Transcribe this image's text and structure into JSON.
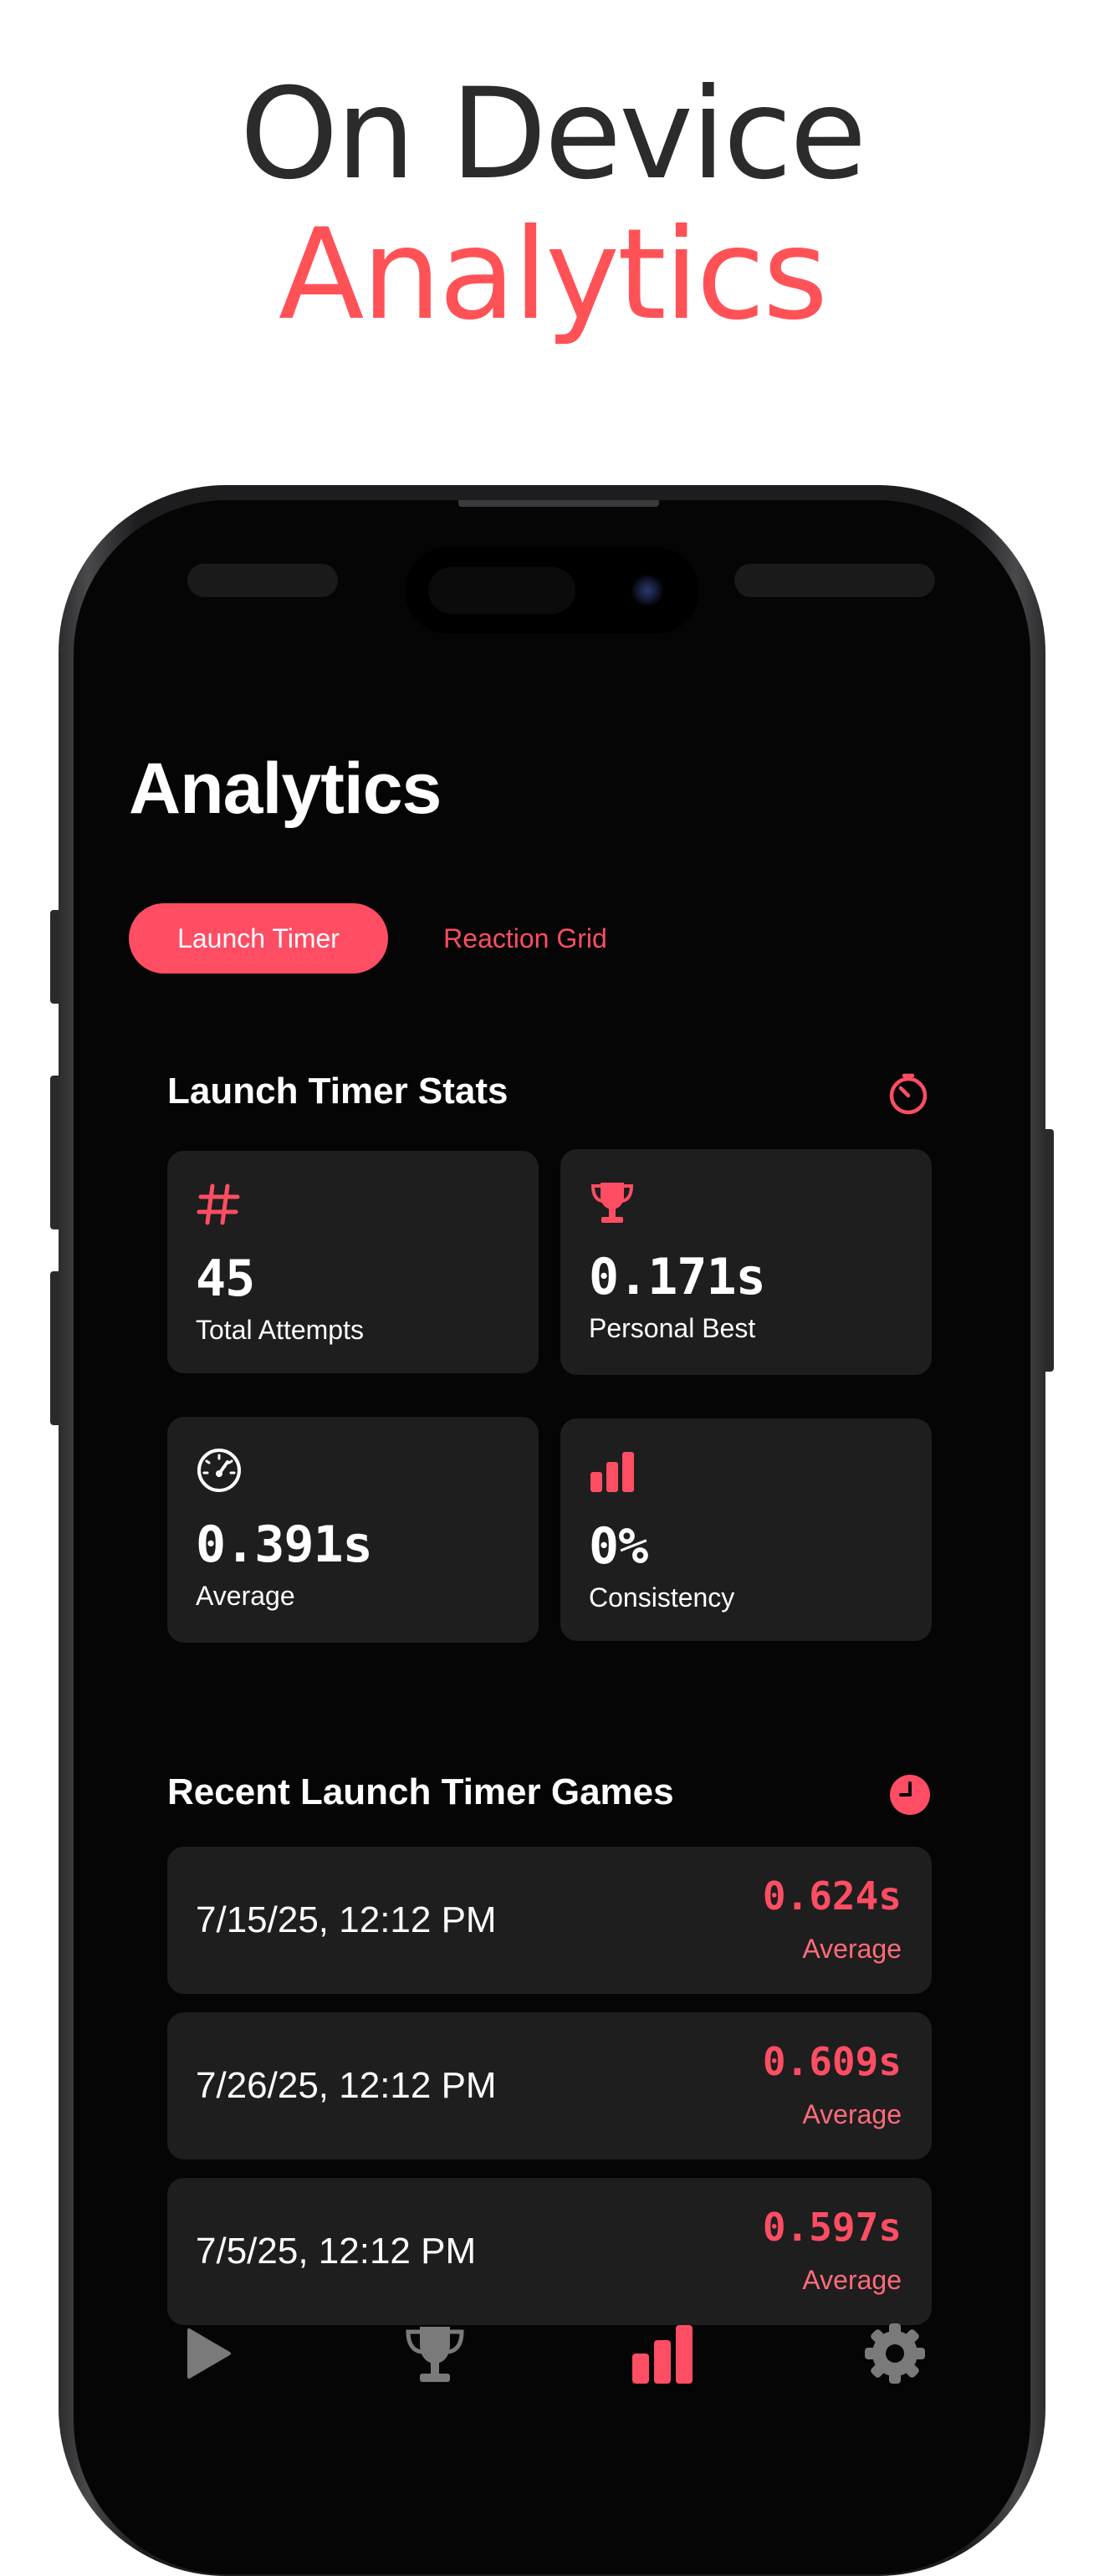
{
  "headline": {
    "line1": "On Device",
    "line2": "Analytics"
  },
  "app": {
    "title": "Analytics",
    "tabs": [
      {
        "label": "Launch Timer",
        "selected": true
      },
      {
        "label": "Reaction Grid",
        "selected": false
      }
    ],
    "stats_section": {
      "title": "Launch Timer Stats",
      "icon": "timer-icon",
      "cards": [
        {
          "icon": "hash-icon",
          "value": "45",
          "label": "Total Attempts"
        },
        {
          "icon": "trophy-icon",
          "value": "0.171s",
          "label": "Personal Best"
        },
        {
          "icon": "speedometer-icon",
          "value": "0.391s",
          "label": "Average"
        },
        {
          "icon": "bar-chart-icon",
          "value": "0%",
          "label": "Consistency"
        }
      ]
    },
    "recent_section": {
      "title": "Recent Launch Timer Games",
      "icon": "clock-icon",
      "games": [
        {
          "date": "7/15/25, 12:12 PM",
          "time": "0.624s",
          "label": "Average"
        },
        {
          "date": "7/26/25, 12:12 PM",
          "time": "0.609s",
          "label": "Average"
        },
        {
          "date": "7/5/25, 12:12 PM",
          "time": "0.597s",
          "label": "Average"
        }
      ]
    },
    "tab_bar": [
      {
        "icon": "play-icon",
        "active": false
      },
      {
        "icon": "trophy-icon",
        "active": false
      },
      {
        "icon": "bar-chart-icon",
        "active": true
      },
      {
        "icon": "gear-icon",
        "active": false
      }
    ]
  },
  "colors": {
    "accent": "#ff4d63",
    "headline_accent": "#ff5257",
    "background": "#050505",
    "card": "#1e1e1e",
    "tab_inactive": "#7a7a7a"
  }
}
